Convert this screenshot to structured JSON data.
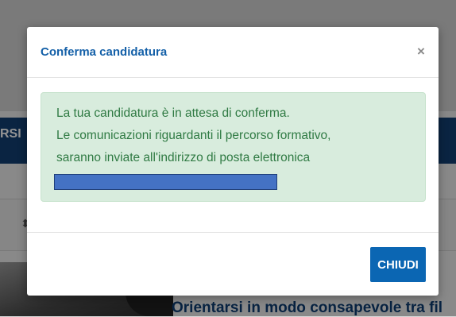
{
  "background": {
    "navbar_fragment": "RSI",
    "section_title": "Orientarsi in modo consapevole tra fil"
  },
  "modal": {
    "title": "Conferma candidatura",
    "close_symbol": "×",
    "message": {
      "line1": "La tua candidatura è in attesa di conferma.",
      "line2": "Le comunicazioni riguardanti il percorso formativo,",
      "line3": "saranno inviate all'indirizzo di posta elettronica"
    },
    "close_button_label": "CHIUDI"
  },
  "colors": {
    "title": "#1460a8",
    "alert_bg": "#d8ecdd",
    "alert_text": "#2f7a43",
    "primary_button": "#0b66b3",
    "redaction": "#4472c4"
  }
}
